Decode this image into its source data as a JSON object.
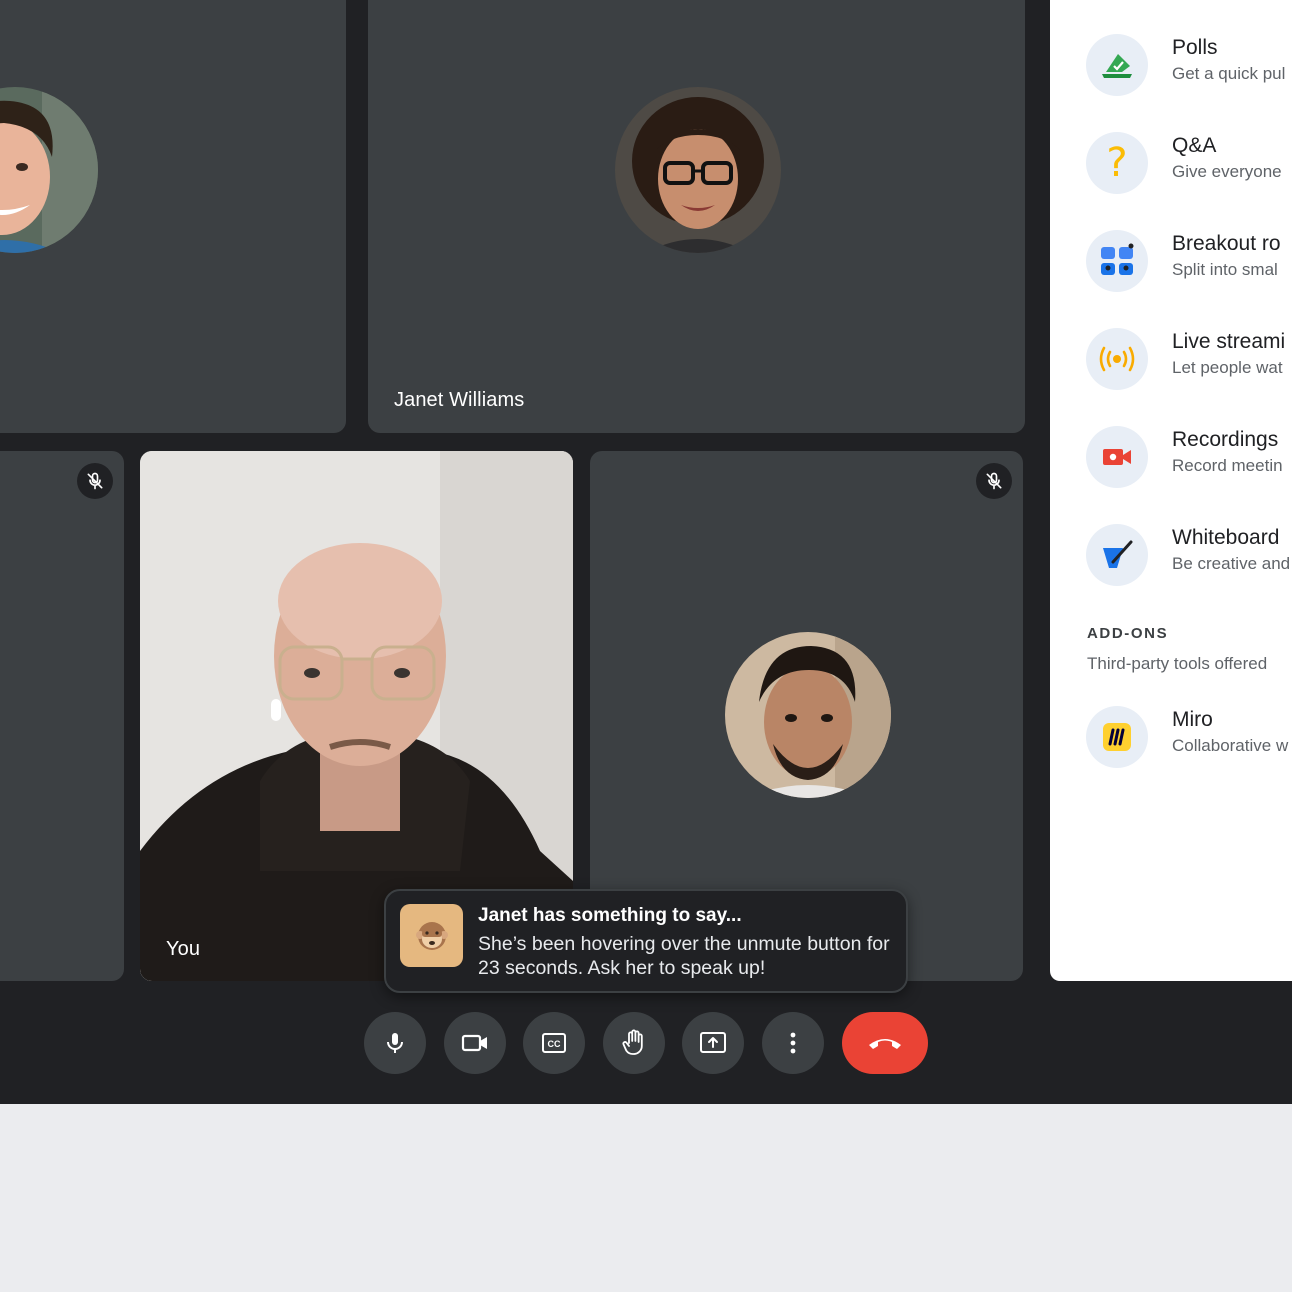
{
  "participants": {
    "janet_name": "Janet Williams",
    "you_name": "You"
  },
  "notification": {
    "title": "Janet has something to say...",
    "body": "She’s been hovering over the unmute button for 23 seconds. Ask her to speak up!",
    "icon": "monkey-emoji-icon"
  },
  "controls": [
    {
      "name": "microphone",
      "icon": "mic-icon"
    },
    {
      "name": "camera",
      "icon": "video-camera-icon"
    },
    {
      "name": "captions",
      "icon": "closed-captions-icon"
    },
    {
      "name": "raise-hand",
      "icon": "hand-icon"
    },
    {
      "name": "present",
      "icon": "present-screen-icon"
    },
    {
      "name": "more-options",
      "icon": "more-vert-icon"
    },
    {
      "name": "leave-call",
      "icon": "end-call-icon"
    }
  ],
  "activities": {
    "items": [
      {
        "title": "Polls",
        "subtitle": "Get a quick pul",
        "icon": "polls-icon"
      },
      {
        "title": "Q&A",
        "subtitle": "Give everyone",
        "icon": "question-icon"
      },
      {
        "title": "Breakout ro",
        "subtitle": "Split into smal",
        "icon": "breakout-rooms-icon"
      },
      {
        "title": "Live streami",
        "subtitle": "Let people wat",
        "icon": "live-stream-icon"
      },
      {
        "title": "Recordings",
        "subtitle": "Record meetin",
        "icon": "recording-icon"
      },
      {
        "title": "Whiteboard",
        "subtitle": "Be creative and",
        "icon": "whiteboard-icon"
      }
    ],
    "addons_heading": "ADD-ONS",
    "addons_subtitle": "Third-party tools offered",
    "addons": [
      {
        "title": "Miro",
        "subtitle": "Collaborative w",
        "icon": "miro-icon"
      }
    ]
  },
  "colors": {
    "stage_bg": "#202124",
    "tile_bg": "#3c4043",
    "end_call": "#ea4335",
    "panel_bg": "#ffffff",
    "toast_icon_bg": "#e5b880"
  }
}
